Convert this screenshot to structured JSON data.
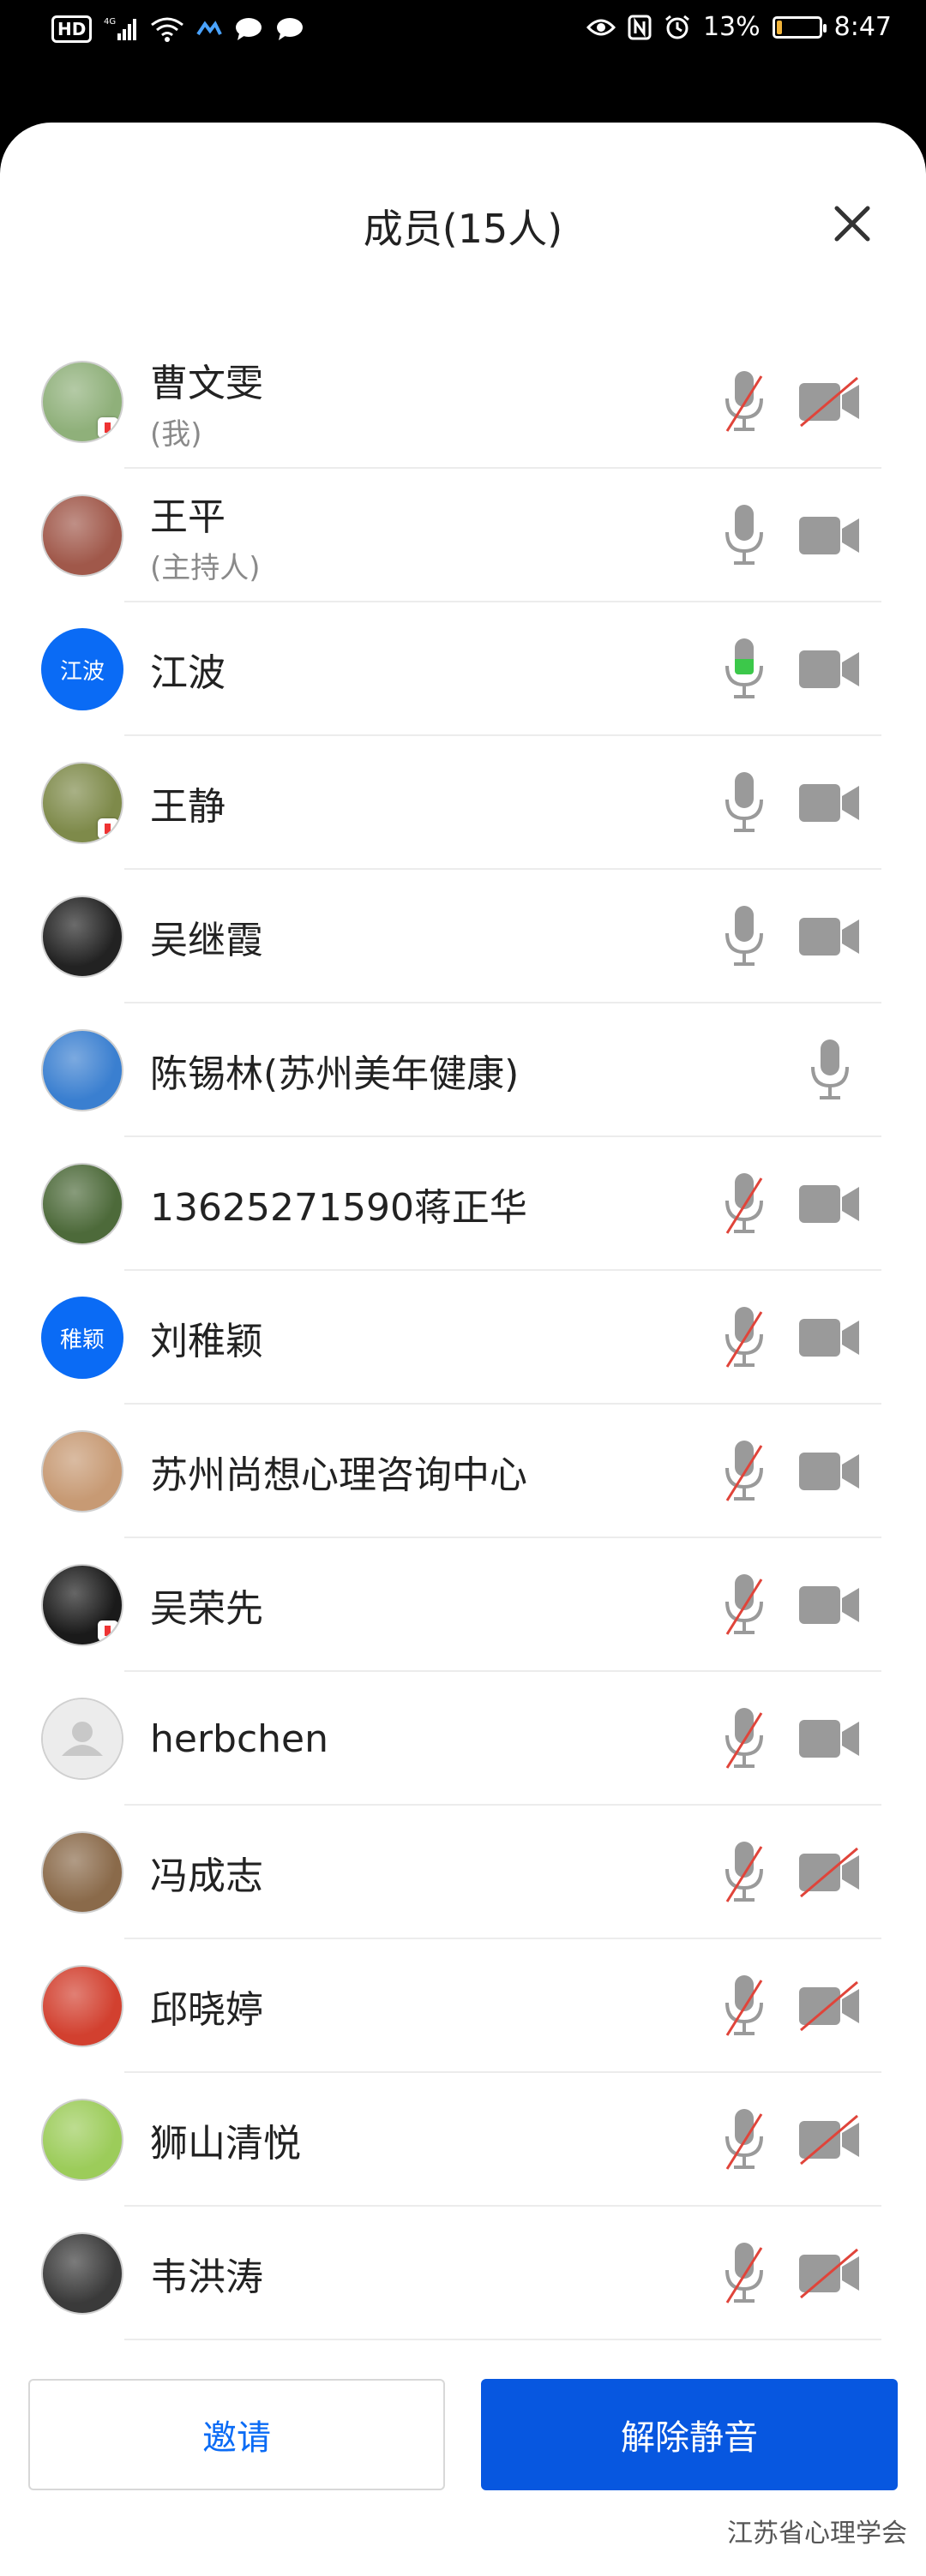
{
  "status_bar": {
    "network": "HD",
    "signal_type": "4G",
    "battery_percent": "13%",
    "battery_level": 0.13,
    "time": "8:47"
  },
  "sheet": {
    "title": "成员(15人)"
  },
  "members": [
    {
      "name": "曹文雯",
      "sub": "(我)",
      "avatar": {
        "type": "photo",
        "color": "#8fb07a",
        "badge": true
      },
      "mic": "muted",
      "camera": "off"
    },
    {
      "name": "王平",
      "sub": "(主持人)",
      "avatar": {
        "type": "photo",
        "color": "#a0584a",
        "badge": false
      },
      "mic": "on",
      "camera": "on"
    },
    {
      "name": "江波",
      "sub": "",
      "avatar": {
        "type": "text",
        "text": "江波"
      },
      "mic": "speaking",
      "camera": "on"
    },
    {
      "name": "王静",
      "sub": "",
      "avatar": {
        "type": "photo",
        "color": "#7e8a4a",
        "badge": true
      },
      "mic": "on",
      "camera": "on"
    },
    {
      "name": "吴继霞",
      "sub": "",
      "avatar": {
        "type": "photo",
        "color": "#222222",
        "badge": false
      },
      "mic": "on",
      "camera": "on"
    },
    {
      "name": "陈锡林(苏州美年健康)",
      "sub": "",
      "avatar": {
        "type": "photo",
        "color": "#3a7fd0",
        "badge": false
      },
      "mic": "on",
      "camera": "none"
    },
    {
      "name": "13625271590蒋正华",
      "sub": "",
      "avatar": {
        "type": "photo",
        "color": "#4d6a3a",
        "badge": false
      },
      "mic": "muted",
      "camera": "on"
    },
    {
      "name": "刘稚颖",
      "sub": "",
      "avatar": {
        "type": "text",
        "text": "稚颖"
      },
      "mic": "muted",
      "camera": "on"
    },
    {
      "name": "苏州尚想心理咨询中心",
      "sub": "",
      "avatar": {
        "type": "photo",
        "color": "#c79a74",
        "badge": false
      },
      "mic": "muted",
      "camera": "on"
    },
    {
      "name": "吴荣先",
      "sub": "",
      "avatar": {
        "type": "photo",
        "color": "#1a1a1a",
        "badge": true
      },
      "mic": "muted",
      "camera": "on"
    },
    {
      "name": "herbchen",
      "sub": "",
      "avatar": {
        "type": "default"
      },
      "mic": "muted",
      "camera": "on"
    },
    {
      "name": "冯成志",
      "sub": "",
      "avatar": {
        "type": "photo",
        "color": "#8a6a4a",
        "badge": false
      },
      "mic": "muted",
      "camera": "off"
    },
    {
      "name": "邱晓婷",
      "sub": "",
      "avatar": {
        "type": "photo",
        "color": "#d2402f",
        "badge": false
      },
      "mic": "muted",
      "camera": "off"
    },
    {
      "name": "狮山清悦",
      "sub": "",
      "avatar": {
        "type": "photo",
        "color": "#9ccc5a",
        "badge": false
      },
      "mic": "muted",
      "camera": "off"
    },
    {
      "name": "韦洪涛",
      "sub": "",
      "avatar": {
        "type": "photo",
        "color": "#3a3a3a",
        "badge": false
      },
      "mic": "muted",
      "camera": "off"
    }
  ],
  "actions": {
    "invite_label": "邀请",
    "unmute_label": "解除静音"
  },
  "watermark": "江苏省心理学会",
  "colors": {
    "accent": "#0757e0",
    "icon_gray": "#9a9a9a",
    "muted_red": "#e0443a",
    "speaking_green": "#3cc84a"
  }
}
